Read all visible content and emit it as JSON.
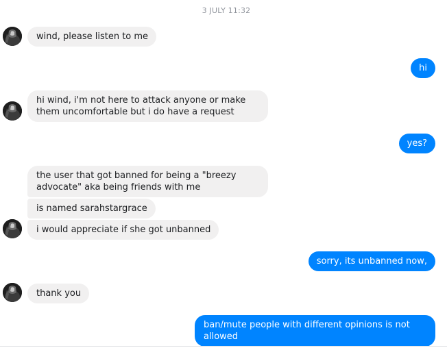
{
  "conversation": {
    "timestamp": "3 JULY 11:32",
    "messages": [
      {
        "from": "them",
        "text": "wind, please listen to me"
      },
      {
        "from": "me",
        "text": "hi"
      },
      {
        "from": "them",
        "text": "hi wind, i'm not here to attack anyone or make them uncomfortable but i do have a request"
      },
      {
        "from": "me",
        "text": "yes?"
      },
      {
        "from": "them",
        "text": "the user that got banned for being a \"breezy advocate\" aka being friends with me"
      },
      {
        "from": "them",
        "text": "is named sarahstargrace"
      },
      {
        "from": "them",
        "text": "i would appreciate if she got unbanned"
      },
      {
        "from": "me",
        "text": "sorry, its unbanned now,"
      },
      {
        "from": "them",
        "text": "thank you"
      },
      {
        "from": "me",
        "text": "ban/mute people with different opinions is not allowed"
      }
    ]
  },
  "colors": {
    "outgoing_bubble": "#0084ff",
    "incoming_bubble": "#f1f0f0",
    "timestamp_text": "#90949c"
  },
  "icons": {
    "contact_avatar": "contact-avatar-icon"
  }
}
